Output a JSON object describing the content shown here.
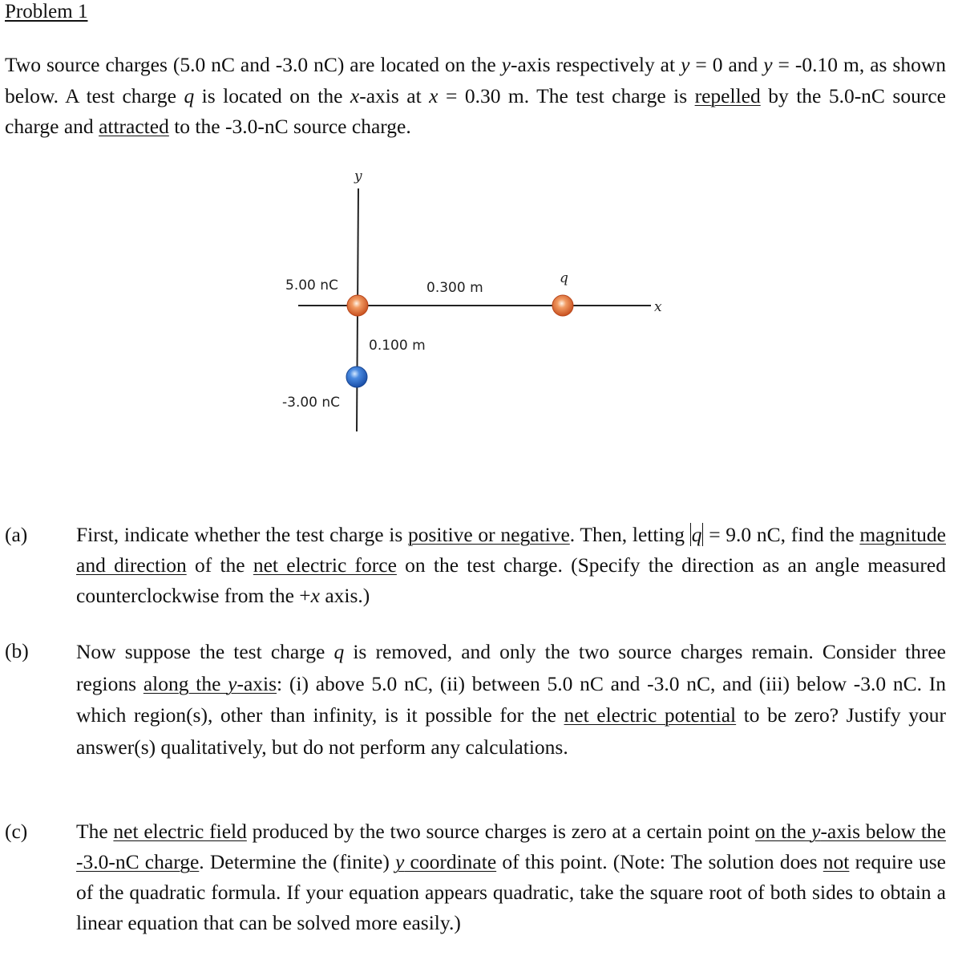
{
  "title": "Problem 1",
  "intro": {
    "t1": "Two source charges (5.0 nC and -3.0 nC) are located on the ",
    "y_var": "y",
    "t2": "-axis respectively at ",
    "y_var2": "y",
    "t3": " = 0 and ",
    "y_var3": "y",
    "t4": " = -0.10 m, as shown below.  A test charge ",
    "q_var": "q",
    "t5": " is located on the ",
    "x_var": "x",
    "t6": "-axis at ",
    "x_var2": "x",
    "t7": " = 0.30 m.  The test charge is ",
    "u_repelled": "repelled",
    "t8": " by the 5.0-nC source charge and ",
    "u_attracted": "attracted",
    "t9": " to the -3.0-nC source charge."
  },
  "diagram": {
    "y_axis_label": "y",
    "x_axis_label": "x",
    "charge1_label": "5.00 nC",
    "charge2_label": "-3.00 nC",
    "test_charge_label": "q",
    "distance_x_label": "0.300 m",
    "distance_y_label": "0.100 m",
    "colors": {
      "positive_charge": "#e0703a",
      "negative_charge": "#2a66c8",
      "axis": "#222222"
    }
  },
  "parts": {
    "a": {
      "label": "(a)",
      "t1": "First, indicate whether the test charge is ",
      "u1": "positive or negative",
      "t2": ".  Then, letting ",
      "abs_q": "q",
      "t3": " = 9.0 nC, find the ",
      "u2": "magnitude and direction",
      "t4": " of the ",
      "u3": "net electric force",
      "t5": " on the test charge.  (Specify the direction as an angle measured counterclockwise from the +",
      "x_var": "x",
      "t6": " axis.)"
    },
    "b": {
      "label": "(b)",
      "t1": "Now suppose the test charge ",
      "q_var": "q",
      "t2": " is removed, and only the two source charges remain.  Consider three regions ",
      "u1": "along the ",
      "y_var": "y",
      "u2": "-axis",
      "t3": ":  (i) above 5.0 nC, (ii) between 5.0 nC and -3.0 nC, and (iii) below -3.0 nC.  In which region(s), other than infinity, is it possible for the ",
      "u3": "net electric potential",
      "t4": " to be zero?  Justify your answer(s) qualitatively, but do not perform any calculations."
    },
    "c": {
      "label": "(c)",
      "t1": "The ",
      "u1": "net electric field",
      "t2": " produced by the two source charges is zero at a certain point ",
      "u2": "on the ",
      "y_var": "y",
      "u3": "-axis below the -3.0-nC charge",
      "t3": ".  Determine the (finite) ",
      "y_var2": "y",
      "u4": " coordinate",
      "t4": " of this point.  (Note: The solution does ",
      "u5": "not",
      "t5": " require use of the quadratic formula.  If your equation appears quadratic, take the square root of both sides to obtain a linear equation that can be solved more easily.)"
    }
  }
}
